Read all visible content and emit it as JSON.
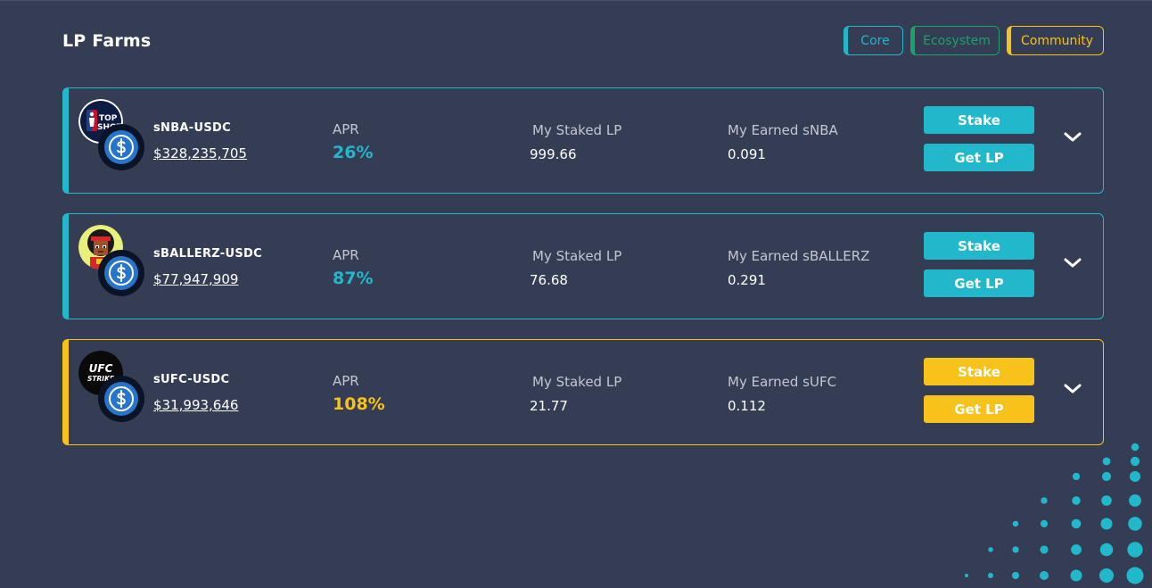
{
  "page": {
    "title": "LP Farms"
  },
  "filters": [
    {
      "label": "Core"
    },
    {
      "label": "Ecosystem"
    },
    {
      "label": "Community"
    }
  ],
  "colors": {
    "core": "#22b8cc",
    "ecosystem": "#1aa26b",
    "community": "#f7c21a",
    "background": "#353d54"
  },
  "farms": [
    {
      "pair": "sNBA-USDC",
      "tvl": "$328,235,705",
      "apr_label": "APR",
      "apr": "26%",
      "staked_label": "My Staked LP",
      "staked": "999.66",
      "earned_label": "My Earned sNBA",
      "earned": "0.091",
      "stake_label": "Stake",
      "getlp_label": "Get LP",
      "logo": {
        "icon": "nba-top-shot-logo",
        "text_top": "TOP",
        "text_bottom": "SHOT"
      },
      "category": "core"
    },
    {
      "pair": "sBALLERZ-USDC",
      "tvl": "$77,947,909",
      "apr_label": "APR",
      "apr": "87%",
      "staked_label": "My Staked LP",
      "staked": "76.68",
      "earned_label": "My Earned sBALLERZ",
      "earned": "0.291",
      "stake_label": "Stake",
      "getlp_label": "Get LP",
      "logo": {
        "icon": "ballerz-avatar"
      },
      "category": "core"
    },
    {
      "pair": "sUFC-USDC",
      "tvl": "$31,993,646",
      "apr_label": "APR",
      "apr": "108%",
      "staked_label": "My Staked LP",
      "staked": "21.77",
      "earned_label": "My Earned sUFC",
      "earned": "0.112",
      "stake_label": "Stake",
      "getlp_label": "Get LP",
      "logo": {
        "icon": "ufc-strike-logo",
        "text_top": "UFC",
        "text_bottom": "STRIKE"
      },
      "category": "community"
    }
  ]
}
